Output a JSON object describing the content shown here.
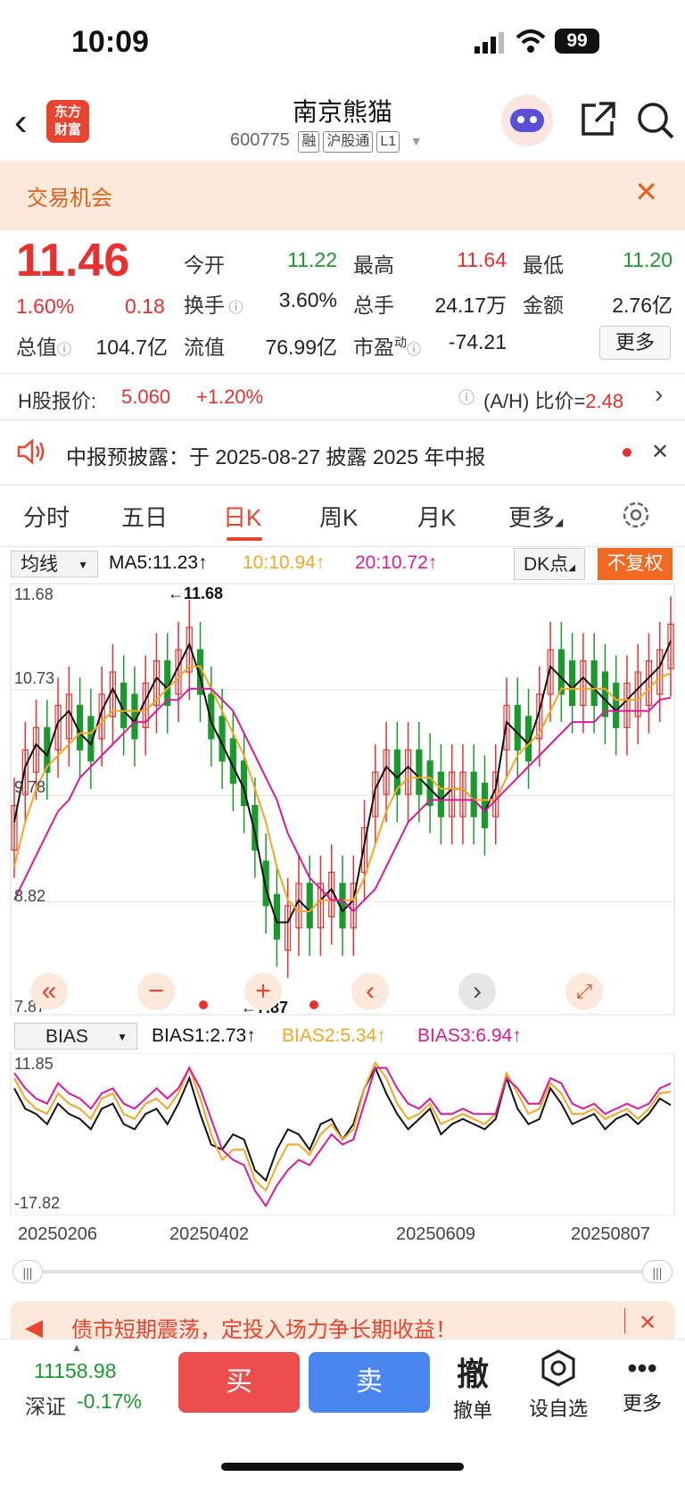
{
  "status": {
    "time": "10:09",
    "battery": "99"
  },
  "header": {
    "logo_line1": "东方",
    "logo_line2": "财富",
    "name": "南京熊猫",
    "code": "600775",
    "tags": [
      "融",
      "沪股通",
      "L1"
    ]
  },
  "banner": {
    "text": "交易机会"
  },
  "quote": {
    "price": "11.46",
    "pct": "1.60%",
    "chg": "0.18",
    "open_label": "今开",
    "open": "11.22",
    "high_label": "最高",
    "high": "11.64",
    "low_label": "最低",
    "low": "11.20",
    "turnover_label": "换手",
    "turnover": "3.60%",
    "volume_label": "总手",
    "volume": "24.17万",
    "amount_label": "金额",
    "amount": "2.76亿",
    "mktcap_label": "总值",
    "mktcap": "104.7亿",
    "float_label": "流值",
    "float": "76.99亿",
    "pe_label": "市盈",
    "pe_sup": "动",
    "pe": "-74.21",
    "more": "更多"
  },
  "hshare": {
    "label": "H股报价:",
    "price": "5.060",
    "pct": "+1.20%",
    "ratio_label": "(A/H) 比价=",
    "ratio": "2.48"
  },
  "notice": {
    "text": "中报预披露：于 2025-08-27 披露 2025 年中报"
  },
  "tabs": [
    "分时",
    "五日",
    "日K",
    "周K",
    "月K",
    "更多"
  ],
  "active_tab": "日K",
  "toolbar": {
    "ma_select": "均线",
    "ma5": "MA5:11.23↑",
    "ma10": "10:10.94↑",
    "ma20": "20:10.72↑",
    "dk": "DK点",
    "adjust": "不复权"
  },
  "kline_labels": {
    "y1": "11.68",
    "y2": "10.73",
    "y3": "9.78",
    "y4": "8.82",
    "y5": "7.87",
    "max_mark": "←11.68",
    "min_mark": "←7.87"
  },
  "bias": {
    "select": "BIAS",
    "b1": "BIAS1:2.73↑",
    "b2": "BIAS2:5.34↑",
    "b3": "BIAS3:6.94↑",
    "top": "11.85",
    "bottom": "-17.82"
  },
  "dates": [
    "20250206",
    "20250402",
    "20250609",
    "20250807"
  ],
  "ad": {
    "text": "债市短期震荡，定投入场力争长期收益！"
  },
  "bottom": {
    "index_value": "11158.98",
    "index_name": "深证",
    "index_pct": "-0.17%",
    "buy": "买",
    "sell": "卖",
    "cancel_icon": "撤",
    "cancel": "撤单",
    "watch": "设自选",
    "more": "更多"
  },
  "colors": {
    "up": "#e8312f",
    "down": "#1a9a2c",
    "ma5": "#111111",
    "ma10": "#f5a623",
    "ma20": "#d81b9c",
    "accent": "#f06a23"
  },
  "chart_data": [
    {
      "type": "candlestick",
      "title": "",
      "ylim": [
        7.87,
        11.68
      ],
      "x_ticks": [
        "20250206",
        "20250402",
        "20250609",
        "20250807"
      ],
      "series": [
        {
          "name": "MA5",
          "values": [
            9.6,
            10.1,
            10.3,
            10.2,
            10.5,
            10.6,
            10.4,
            10.3,
            10.6,
            10.8,
            10.6,
            10.5,
            10.7,
            10.9,
            10.8,
            11.0,
            11.2,
            10.9,
            10.5,
            10.3,
            10.1,
            9.9,
            9.5,
            9.0,
            8.7,
            8.7,
            8.9,
            8.8,
            8.9,
            9.0,
            8.8,
            8.9,
            9.4,
            9.9,
            10.1,
            10.0,
            10.1,
            10.0,
            9.9,
            9.8,
            9.9,
            9.9,
            9.8,
            9.7,
            9.9,
            10.5,
            10.4,
            10.3,
            10.6,
            11.0,
            10.9,
            10.8,
            10.9,
            10.8,
            10.7,
            10.6,
            10.7,
            10.8,
            10.9,
            11.0,
            11.23
          ]
        },
        {
          "name": "10",
          "values": [
            9.2,
            9.6,
            9.9,
            10.1,
            10.2,
            10.3,
            10.4,
            10.4,
            10.5,
            10.6,
            10.6,
            10.6,
            10.6,
            10.7,
            10.8,
            10.9,
            11.0,
            11.0,
            10.8,
            10.6,
            10.4,
            10.2,
            9.9,
            9.6,
            9.2,
            8.9,
            8.8,
            8.8,
            8.9,
            8.9,
            8.9,
            8.9,
            9.1,
            9.4,
            9.7,
            9.9,
            10.0,
            10.0,
            10.0,
            9.9,
            9.9,
            9.9,
            9.8,
            9.8,
            9.8,
            10.0,
            10.2,
            10.3,
            10.4,
            10.6,
            10.8,
            10.8,
            10.8,
            10.8,
            10.8,
            10.7,
            10.7,
            10.7,
            10.8,
            10.9,
            10.94
          ]
        },
        {
          "name": "20",
          "values": [
            8.9,
            9.1,
            9.3,
            9.5,
            9.7,
            9.8,
            10.0,
            10.1,
            10.2,
            10.3,
            10.4,
            10.5,
            10.5,
            10.6,
            10.7,
            10.7,
            10.8,
            10.8,
            10.8,
            10.7,
            10.6,
            10.4,
            10.2,
            10.0,
            9.8,
            9.5,
            9.3,
            9.1,
            9.0,
            8.9,
            8.9,
            8.8,
            8.9,
            9.0,
            9.2,
            9.4,
            9.6,
            9.7,
            9.8,
            9.8,
            9.8,
            9.8,
            9.8,
            9.7,
            9.8,
            9.9,
            10.0,
            10.1,
            10.2,
            10.3,
            10.4,
            10.5,
            10.5,
            10.5,
            10.6,
            10.6,
            10.6,
            10.6,
            10.6,
            10.7,
            10.72
          ]
        }
      ]
    },
    {
      "type": "line",
      "title": "",
      "ylim": [
        -17.82,
        11.85
      ],
      "series": [
        {
          "name": "BIAS1",
          "values": [
            6,
            2,
            1,
            -1,
            3,
            1,
            0,
            -2,
            2,
            3,
            -1,
            -2,
            1,
            2,
            -1,
            3,
            8,
            1,
            -5,
            -6,
            -3,
            -4,
            -10,
            -12,
            -6,
            -2,
            -3,
            -6,
            -1,
            0,
            -4,
            -1,
            6,
            10,
            5,
            1,
            -2,
            0,
            2,
            -3,
            -1,
            0,
            -1,
            -2,
            0,
            8,
            2,
            -1,
            0,
            6,
            3,
            -1,
            0,
            1,
            -2,
            0,
            1,
            -1,
            1,
            4,
            2.73
          ]
        },
        {
          "name": "BIAS2",
          "values": [
            8,
            4,
            2,
            1,
            5,
            3,
            2,
            0,
            4,
            5,
            1,
            0,
            3,
            4,
            2,
            5,
            10,
            4,
            -3,
            -8,
            -6,
            -6,
            -12,
            -14,
            -9,
            -5,
            -5,
            -7,
            -3,
            -1,
            -4,
            -2,
            6,
            11,
            8,
            3,
            0,
            1,
            3,
            -1,
            0,
            1,
            0,
            -1,
            1,
            9,
            5,
            1,
            2,
            7,
            5,
            1,
            1,
            2,
            0,
            1,
            2,
            0,
            2,
            5,
            5.34
          ]
        },
        {
          "name": "BIAS3",
          "values": [
            9,
            6,
            4,
            3,
            7,
            5,
            4,
            2,
            5,
            6,
            3,
            2,
            4,
            6,
            4,
            6,
            10,
            6,
            0,
            -6,
            -8,
            -9,
            -14,
            -17,
            -13,
            -10,
            -8,
            -9,
            -6,
            -3,
            -5,
            -4,
            3,
            10,
            10,
            6,
            3,
            2,
            4,
            1,
            1,
            2,
            1,
            1,
            1,
            8,
            6,
            3,
            3,
            8,
            7,
            3,
            2,
            3,
            1,
            2,
            3,
            2,
            3,
            6,
            6.94
          ]
        }
      ]
    }
  ]
}
